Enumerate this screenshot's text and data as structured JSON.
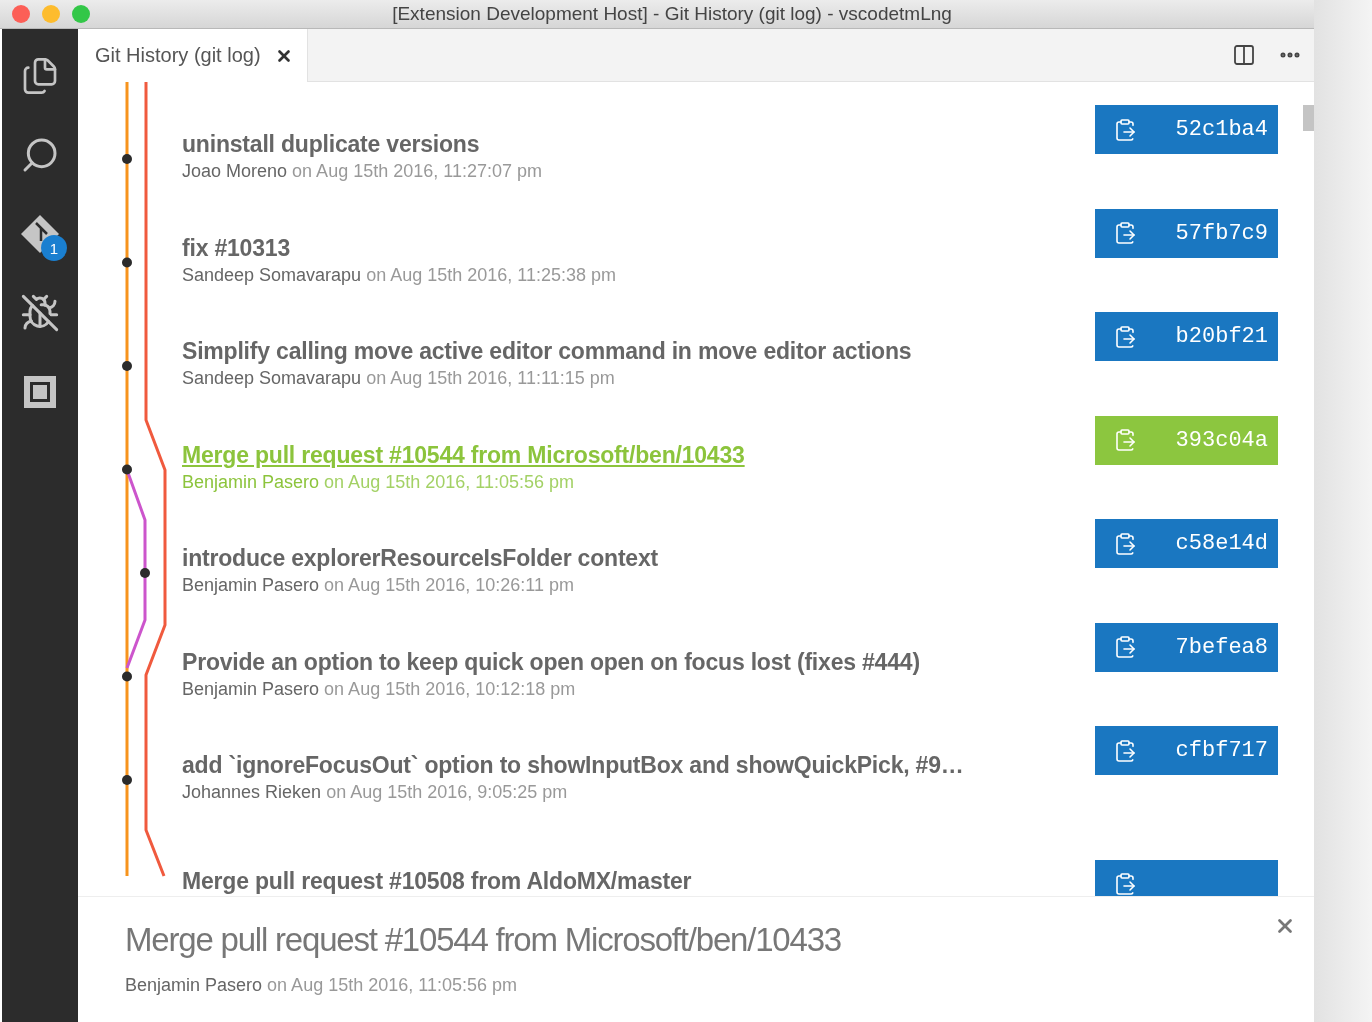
{
  "window": {
    "title": "[Extension Development Host] - Git History (git log) - vscodetmLng"
  },
  "activity_bar": [
    {
      "kind": "files"
    },
    {
      "kind": "search"
    },
    {
      "kind": "git",
      "badge": "1"
    },
    {
      "kind": "debug"
    },
    {
      "kind": "extensions"
    }
  ],
  "tabs": [
    {
      "label": "Git History (git log)",
      "selected": true
    }
  ],
  "commits": [
    {
      "title": "uninstall duplicate versions",
      "author": "Joao Moreno",
      "meta": "on Aug 15th 2016, 11:27:07 pm",
      "hash": "52c1ba4",
      "selected": false,
      "kind": "main"
    },
    {
      "title": "fix #10313",
      "author": "Sandeep Somavarapu",
      "meta": "on Aug 15th 2016, 11:25:38 pm",
      "hash": "57fb7c9",
      "selected": false,
      "kind": "main"
    },
    {
      "title": "Simplify calling move active editor command in move editor actions",
      "author": "Sandeep Somavarapu",
      "meta": "on Aug 15th 2016, 11:11:15 pm",
      "hash": "b20bf21",
      "selected": false,
      "kind": "main"
    },
    {
      "title": "Merge pull request #10544 from Microsoft/ben/10433",
      "author": "Benjamin Pasero",
      "meta": "on Aug 15th 2016, 11:05:56 pm",
      "hash": "393c04a",
      "selected": true,
      "kind": "main"
    },
    {
      "title": "introduce explorerResourceIsFolder context",
      "author": "Benjamin Pasero",
      "meta": "on Aug 15th 2016, 10:26:11 pm",
      "hash": "c58e14d",
      "selected": false,
      "kind": "branch"
    },
    {
      "title": "Provide an option to keep quick open open on focus lost (fixes #444)",
      "author": "Benjamin Pasero",
      "meta": "on Aug 15th 2016, 10:12:18 pm",
      "hash": "7befea8",
      "selected": false,
      "kind": "main"
    },
    {
      "title": "add `ignoreFocusOut` option to showInputBox and showQuickPick, #9…",
      "author": "Johannes Rieken",
      "meta": "on Aug 15th 2016, 9:05:25 pm",
      "hash": "cfbf717",
      "selected": false,
      "kind": "main"
    },
    {
      "title": "Merge pull request #10508 from AldoMX/master",
      "selected": false,
      "kind": "none"
    }
  ],
  "details": {
    "title": "Merge pull request #10544 from Microsoft/ben/10433",
    "author": "Benjamin Pasero",
    "meta": "on Aug 15th 2016, 11:05:56 pm"
  }
}
